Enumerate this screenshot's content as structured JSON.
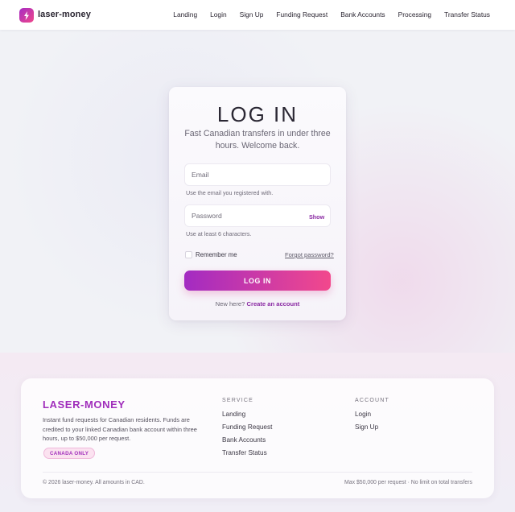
{
  "header": {
    "brand": "laser-money",
    "nav": [
      "Landing",
      "Login",
      "Sign Up",
      "Funding Request",
      "Bank Accounts",
      "Processing",
      "Transfer Status"
    ]
  },
  "login": {
    "title": "LOG IN",
    "subtitle": "Fast Canadian transfers in under three hours. Welcome back.",
    "email_placeholder": "Email",
    "email_hint": "Use the email you registered with.",
    "password_placeholder": "Password",
    "show_label": "Show",
    "password_hint": "Use at least 6 characters.",
    "remember_label": "Remember me",
    "forgot_label": "Forgot password?",
    "submit_label": "LOG IN",
    "new_here": "New here?",
    "create_account": "Create an account"
  },
  "footer": {
    "brand": "LASER-MONEY",
    "description": "Instant fund requests for Canadian residents. Funds are credited to your linked Canadian bank account within three hours, up to $50,000 per request.",
    "badge": "CANADA ONLY",
    "service_heading": "SERVICE",
    "service_links": [
      "Landing",
      "Funding Request",
      "Bank Accounts",
      "Transfer Status"
    ],
    "account_heading": "ACCOUNT",
    "account_links": [
      "Login",
      "Sign Up"
    ],
    "copyright": "© 2026 laser-money. All amounts in CAD.",
    "limit_note": "Max $50,000 per request · No limit on total transfers"
  },
  "colors": {
    "accent": "#a02dbb",
    "gradient_start": "#a32bc2",
    "gradient_end": "#f2488c"
  },
  "icons": {
    "logo": "lightning-bolt-icon"
  }
}
